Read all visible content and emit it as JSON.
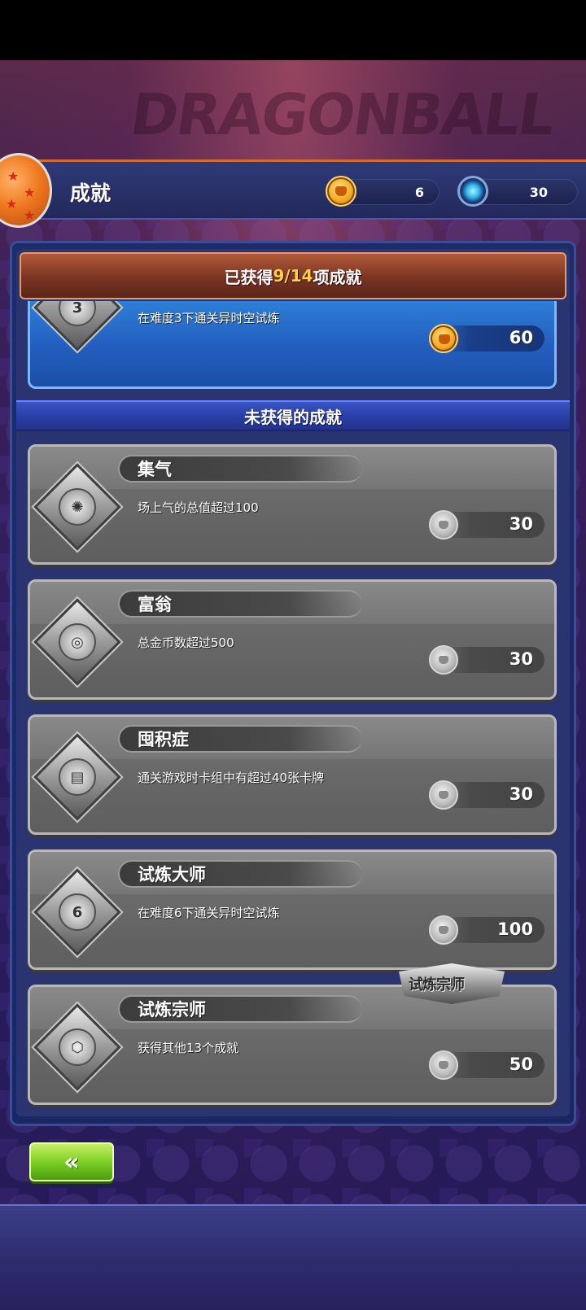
{
  "header": {
    "title": "成就",
    "currencies": [
      {
        "icon": "gold-medal-icon",
        "value": "6"
      },
      {
        "icon": "blue-gem-icon",
        "value": "30"
      }
    ]
  },
  "summary": {
    "prefix": "已获得",
    "progress": "9/14",
    "suffix": "项成就"
  },
  "obtained_item": {
    "badge_number": "3",
    "description": "在难度3下通关异时空试炼",
    "reward": "60",
    "reward_icon": "gold-medal-icon"
  },
  "unobtained_section": {
    "title": "未获得的成就",
    "items": [
      {
        "name": "集气",
        "description": "场上气的总值超过100",
        "reward": "30",
        "badge_icon": "ki-blast-badge-icon"
      },
      {
        "name": "富翁",
        "description": "总金币数超过500",
        "reward": "30",
        "badge_icon": "coins-badge-icon"
      },
      {
        "name": "囤积症",
        "description": "通关游戏时卡组中有超过40张卡牌",
        "reward": "30",
        "badge_icon": "cards-badge-icon"
      },
      {
        "name": "试炼大师",
        "description": "在难度6下通关异时空试炼",
        "reward": "100",
        "badge_icon": "star-6-badge-icon",
        "badge_number": "6"
      },
      {
        "name": "试炼宗师",
        "description": "获得其他13个成就",
        "reward": "50",
        "badge_icon": "hexagon-badge-icon"
      }
    ]
  },
  "title_ribbon": {
    "text": "试炼宗师"
  },
  "back_button": {
    "label": "«"
  },
  "colors": {
    "header_accent": "#d46a30",
    "progress_highlight": "#ffd23a",
    "obtained_card": "#2460c0",
    "locked_card": "#6a6a6a",
    "back_button": "#7ccf24"
  }
}
